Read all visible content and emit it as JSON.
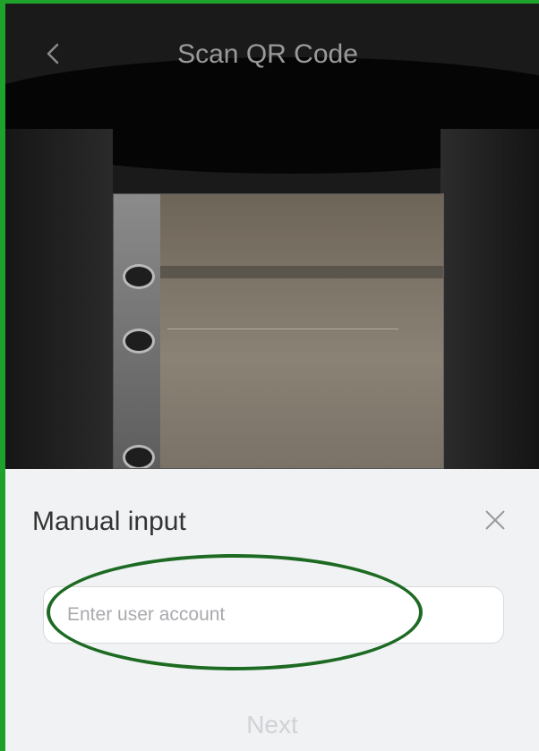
{
  "header": {
    "title": "Scan QR Code",
    "back_icon": "chevron-left-icon"
  },
  "manual_input": {
    "title": "Manual input",
    "close_icon": "close-icon",
    "account_placeholder": "Enter user account",
    "account_value": "",
    "next_label": "Next"
  },
  "colors": {
    "border_accent": "#1fa22c",
    "annotation_circle": "#1d6a22",
    "panel_background": "#f1f2f4",
    "camera_background": "#1a1a1a"
  }
}
